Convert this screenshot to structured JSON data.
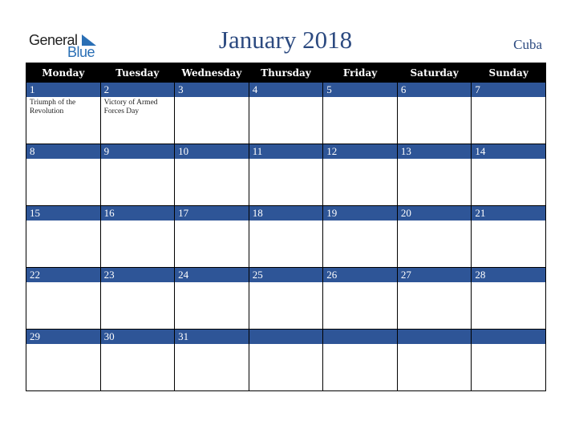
{
  "logo": {
    "general": "General",
    "blue": "Blue"
  },
  "header": {
    "title": "January 2018",
    "country": "Cuba"
  },
  "weekdays": [
    "Monday",
    "Tuesday",
    "Wednesday",
    "Thursday",
    "Friday",
    "Saturday",
    "Sunday"
  ],
  "weeks": [
    [
      {
        "day": "1",
        "holiday": "Triumph of the Revolution"
      },
      {
        "day": "2",
        "holiday": "Victory of Armed Forces Day"
      },
      {
        "day": "3",
        "holiday": ""
      },
      {
        "day": "4",
        "holiday": ""
      },
      {
        "day": "5",
        "holiday": ""
      },
      {
        "day": "6",
        "holiday": ""
      },
      {
        "day": "7",
        "holiday": ""
      }
    ],
    [
      {
        "day": "8",
        "holiday": ""
      },
      {
        "day": "9",
        "holiday": ""
      },
      {
        "day": "10",
        "holiday": ""
      },
      {
        "day": "11",
        "holiday": ""
      },
      {
        "day": "12",
        "holiday": ""
      },
      {
        "day": "13",
        "holiday": ""
      },
      {
        "day": "14",
        "holiday": ""
      }
    ],
    [
      {
        "day": "15",
        "holiday": ""
      },
      {
        "day": "16",
        "holiday": ""
      },
      {
        "day": "17",
        "holiday": ""
      },
      {
        "day": "18",
        "holiday": ""
      },
      {
        "day": "19",
        "holiday": ""
      },
      {
        "day": "20",
        "holiday": ""
      },
      {
        "day": "21",
        "holiday": ""
      }
    ],
    [
      {
        "day": "22",
        "holiday": ""
      },
      {
        "day": "23",
        "holiday": ""
      },
      {
        "day": "24",
        "holiday": ""
      },
      {
        "day": "25",
        "holiday": ""
      },
      {
        "day": "26",
        "holiday": ""
      },
      {
        "day": "27",
        "holiday": ""
      },
      {
        "day": "28",
        "holiday": ""
      }
    ],
    [
      {
        "day": "29",
        "holiday": ""
      },
      {
        "day": "30",
        "holiday": ""
      },
      {
        "day": "31",
        "holiday": ""
      },
      {
        "day": "",
        "holiday": ""
      },
      {
        "day": "",
        "holiday": ""
      },
      {
        "day": "",
        "holiday": ""
      },
      {
        "day": "",
        "holiday": ""
      }
    ]
  ],
  "colors": {
    "band": "#2e5597",
    "title": "#2c4a80",
    "header_bg": "#000000"
  }
}
